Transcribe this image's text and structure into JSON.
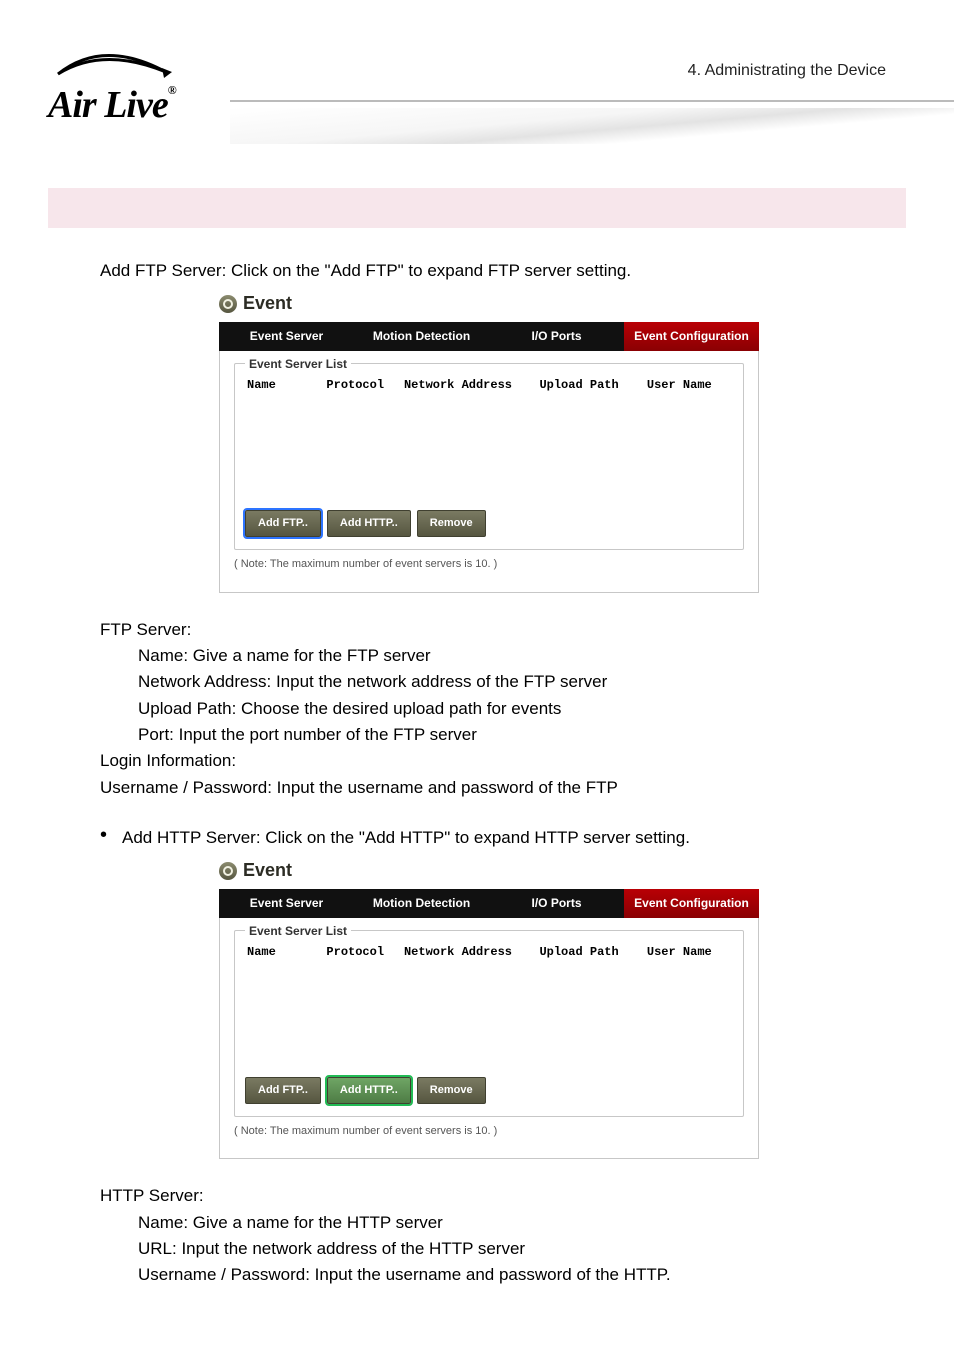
{
  "chapter": "4. Administrating the Device",
  "logo": {
    "text": "Air Live",
    "reg": "®"
  },
  "sec1": {
    "intro": "Add FTP Server: Click on the \"Add FTP\" to expand FTP server setting.",
    "after_head": "FTP Server:",
    "lines": [
      "Name: Give a name for the FTP server",
      "Network Address: Input the network address of the FTP server",
      "Upload Path: Choose the desired upload path for events",
      "Port: Input the port number of the FTP server"
    ],
    "login_head": "Login Information:",
    "login_line": "Username / Password: Input the username and password of the FTP"
  },
  "sec2": {
    "intro": "Add HTTP Server: Click on the \"Add HTTP\" to expand HTTP server setting.",
    "after_head": "HTTP Server:",
    "lines": [
      "Name: Give a name for the HTTP server",
      "URL: Input the network address of the HTTP server",
      "Username / Password: Input the username and password of the HTTP."
    ]
  },
  "shot": {
    "title": "Event",
    "tabs": [
      "Event Server",
      "Motion Detection",
      "I/O Ports",
      "Event Configuration"
    ],
    "legend": "Event Server List",
    "cols": [
      "Name",
      "Protocol",
      "Network Address",
      "Upload Path",
      "User Name"
    ],
    "btn_ftp": "Add FTP..",
    "btn_http": "Add HTTP..",
    "btn_remove": "Remove",
    "note": "( Note: The maximum number of event servers is 10. )"
  }
}
